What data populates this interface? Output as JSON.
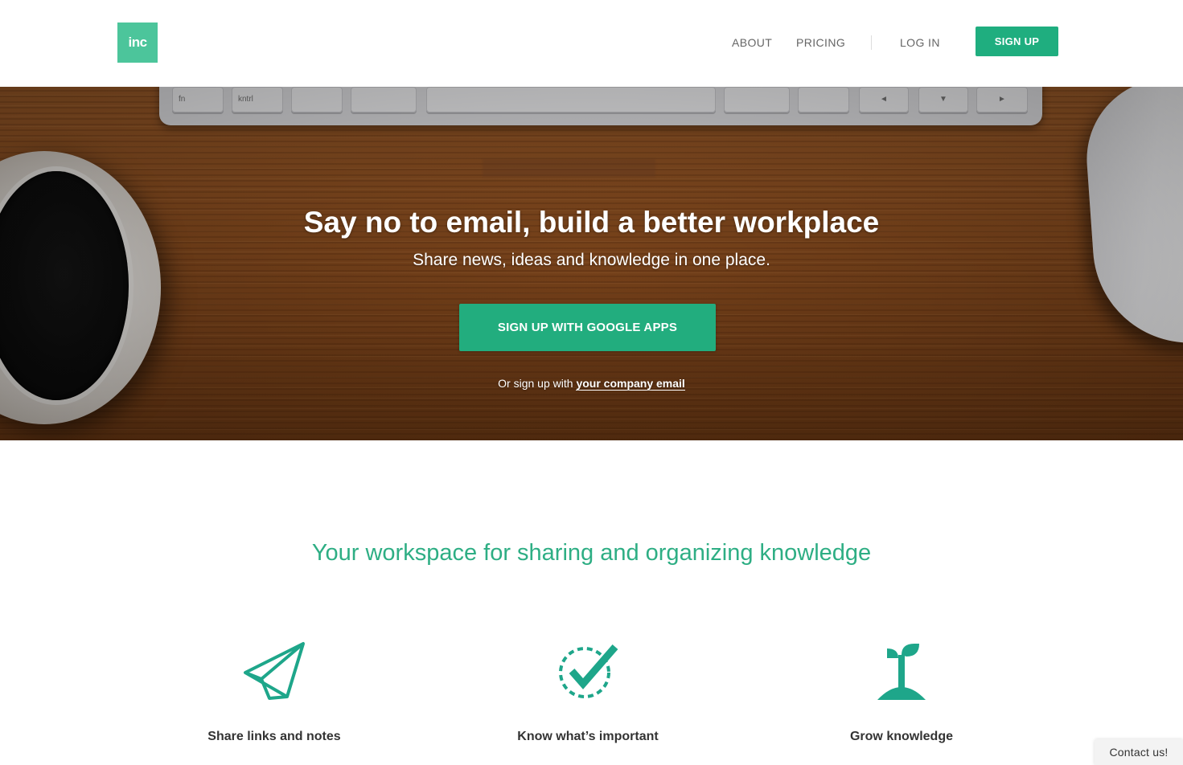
{
  "header": {
    "logo_text": "inc",
    "nav": {
      "about": "ABOUT",
      "pricing": "PRICING",
      "login": "LOG IN",
      "signup": "SIGN UP"
    }
  },
  "hero": {
    "title": "Say no to email, build a better workplace",
    "subtitle": "Share news, ideas and knowledge in one place.",
    "google_button": "SIGN UP WITH GOOGLE APPS",
    "alt_prefix": "Or sign up with ",
    "alt_link": "your company email",
    "keyboard_keys": [
      "fn",
      "kntrl",
      "",
      "",
      "",
      "",
      "",
      "◄",
      "▼",
      "►"
    ]
  },
  "features": {
    "tagline": "Your workspace for sharing and organizing knowledge",
    "items": [
      {
        "label": "Share links and notes",
        "icon": "paper-plane-icon"
      },
      {
        "label": "Know what’s important",
        "icon": "check-circle-icon"
      },
      {
        "label": "Grow knowledge",
        "icon": "sprout-icon"
      }
    ]
  },
  "contact": {
    "label": "Contact us!"
  },
  "colors": {
    "brand": "#4cc59b",
    "button": "#1fae7f",
    "tagline": "#2eae84"
  }
}
